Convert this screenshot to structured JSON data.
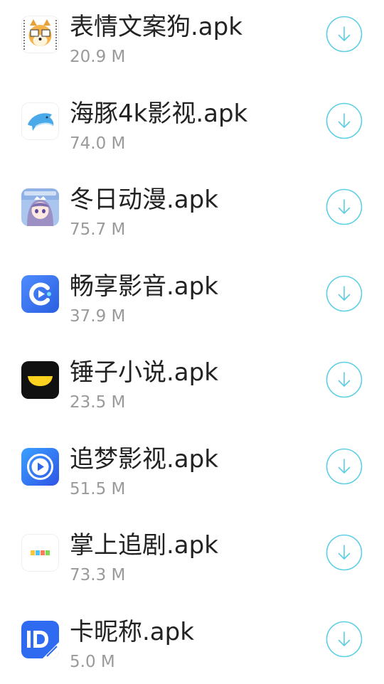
{
  "files": [
    {
      "name": "表情文案狗.apk",
      "size": "20.9 M",
      "icon": "doge-meme-app-icon"
    },
    {
      "name": "海豚4k影视.apk",
      "size": "74.0 M",
      "icon": "dolphin-app-icon"
    },
    {
      "name": "冬日动漫.apk",
      "size": "75.7 M",
      "icon": "anime-girl-app-icon"
    },
    {
      "name": "畅享影音.apk",
      "size": "37.9 M",
      "icon": "play-c-app-icon"
    },
    {
      "name": "锤子小说.apk",
      "size": "23.5 M",
      "icon": "smiling-face-app-icon"
    },
    {
      "name": "追梦影视.apk",
      "size": "51.5 M",
      "icon": "play-circle-app-icon"
    },
    {
      "name": "掌上追剧.apk",
      "size": "73.3 M",
      "icon": "colorful-blocks-app-icon"
    },
    {
      "name": "卡昵称.apk",
      "size": "5.0 M",
      "icon": "id-badge-app-icon"
    }
  ],
  "colors": {
    "download_accent": "#5ccfe6",
    "name_text": "#222222",
    "size_text": "#9a9a9a"
  },
  "download_icon": "download-arrow-icon"
}
